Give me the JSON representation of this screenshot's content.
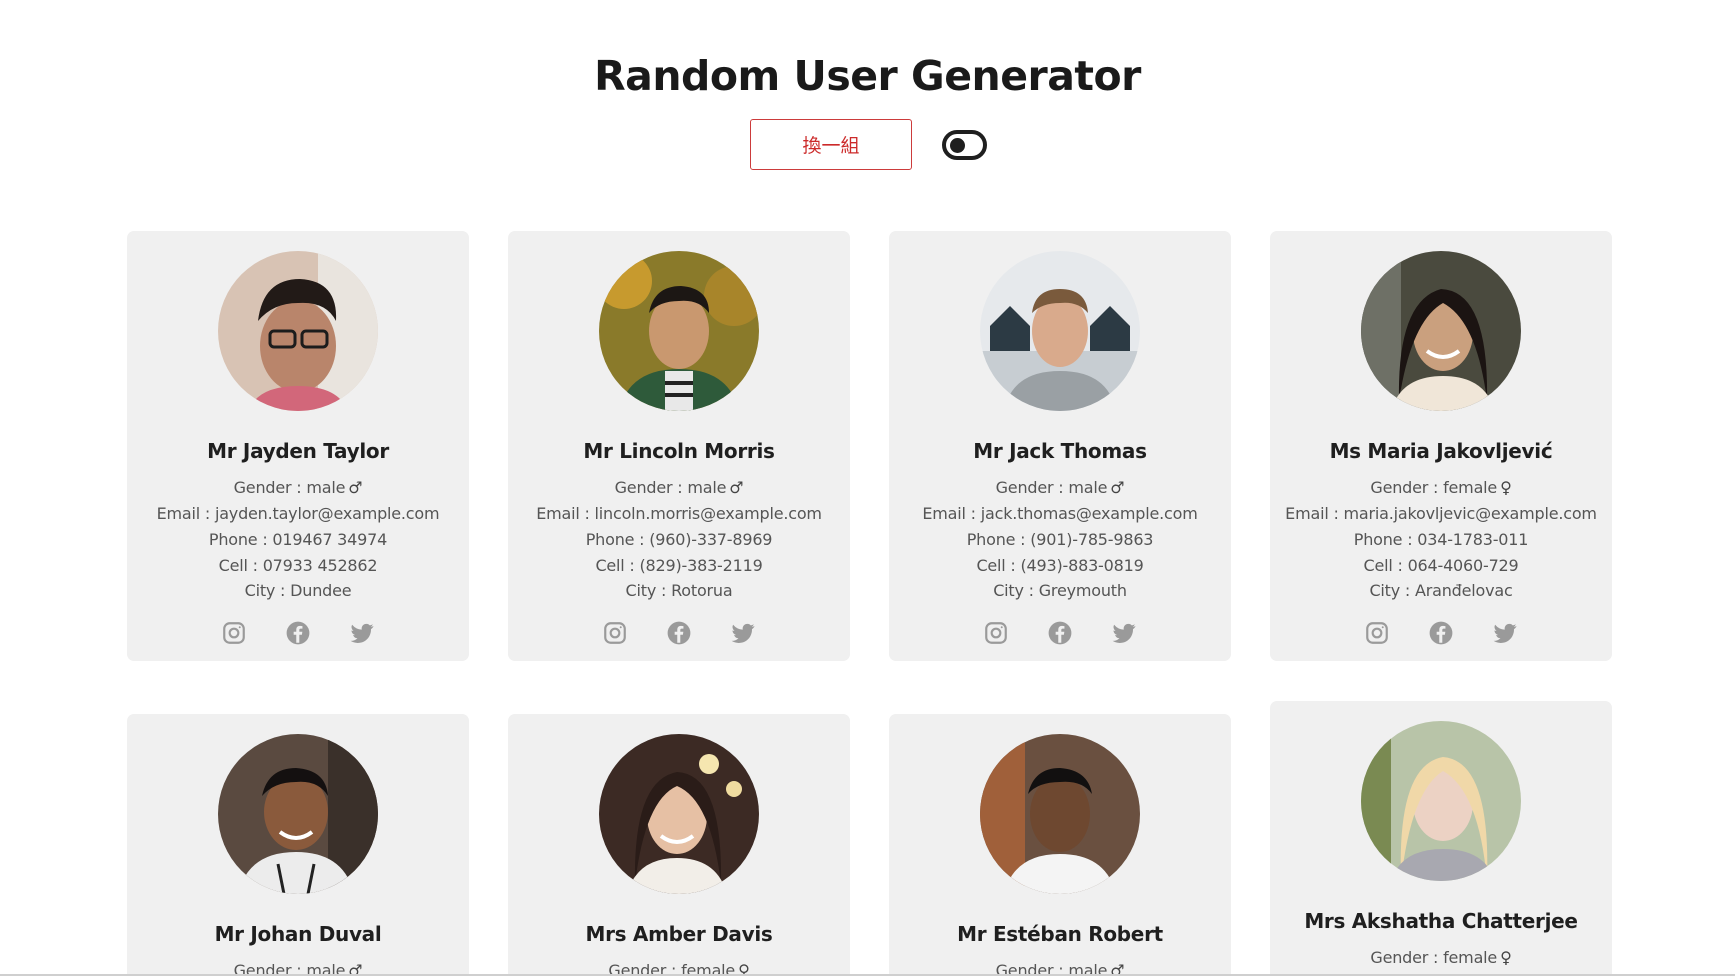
{
  "header": {
    "title": "Random User Generator",
    "shuffle_label": "換一組"
  },
  "labels": {
    "gender": "Gender : ",
    "email": "Email : ",
    "phone": "Phone : ",
    "cell": "Cell : ",
    "city": "City : "
  },
  "users": [
    {
      "name": "Mr Jayden Taylor",
      "gender": "male",
      "gender_symbol": "♂",
      "email": "jayden.taylor@example.com",
      "phone": "019467 34974",
      "cell": "07933 452862",
      "city": "Dundee"
    },
    {
      "name": "Mr Lincoln Morris",
      "gender": "male",
      "gender_symbol": "♂",
      "email": "lincoln.morris@example.com",
      "phone": "(960)-337-8969",
      "cell": "(829)-383-2119",
      "city": "Rotorua"
    },
    {
      "name": "Mr Jack Thomas",
      "gender": "male",
      "gender_symbol": "♂",
      "email": "jack.thomas@example.com",
      "phone": "(901)-785-9863",
      "cell": "(493)-883-0819",
      "city": "Greymouth"
    },
    {
      "name": "Ms Maria Jakovljević",
      "gender": "female",
      "gender_symbol": "♀",
      "email": "maria.jakovljevic@example.com",
      "phone": "034-1783-011",
      "cell": "064-4060-729",
      "city": "Aranđelovac"
    },
    {
      "name": "Mr Johan Duval",
      "gender": "male",
      "gender_symbol": "♂"
    },
    {
      "name": "Mrs Amber Davis",
      "gender": "female",
      "gender_symbol": "♀"
    },
    {
      "name": "Mr Estéban Robert",
      "gender": "male",
      "gender_symbol": "♂"
    },
    {
      "name": "Mrs Akshatha Chatterjee",
      "gender": "female",
      "gender_symbol": "♀"
    }
  ],
  "icons": {
    "social": [
      "instagram-icon",
      "facebook-icon",
      "twitter-icon"
    ],
    "avatar": "user-photo"
  },
  "colors": {
    "accent": "#cc2a2a",
    "card_bg": "#f0f0f0",
    "icon_gray": "#9a9a9a"
  }
}
